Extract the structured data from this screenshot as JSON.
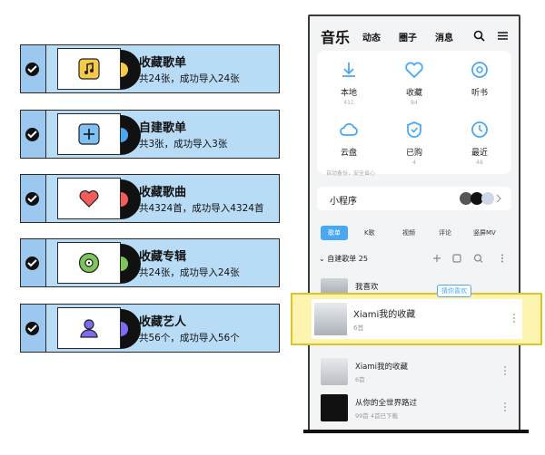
{
  "import_cards": [
    {
      "title": "收藏歌单",
      "subtitle": "共24张，成功导入24张",
      "icon": "music-note-icon",
      "accent": "#f7c948"
    },
    {
      "title": "自建歌单",
      "subtitle": "共3张，成功导入3张",
      "icon": "plus-icon",
      "accent": "#4aa8f2"
    },
    {
      "title": "收藏歌曲",
      "subtitle": "共4324首，成功导入4324首",
      "icon": "heart-icon",
      "accent": "#f25c5c"
    },
    {
      "title": "收藏专辑",
      "subtitle": "共24张，成功导入24张",
      "icon": "album-disc-icon",
      "accent": "#7dc45a"
    },
    {
      "title": "收藏艺人",
      "subtitle": "共56个，成功导入56个",
      "icon": "person-icon",
      "accent": "#7b6cf2"
    }
  ],
  "phone": {
    "tabs": {
      "main": "音乐",
      "t1": "动态",
      "t2": "圈子",
      "t3": "消息"
    },
    "grid": [
      {
        "label": "本地",
        "count": "411",
        "icon": "download-icon"
      },
      {
        "label": "收藏",
        "count": "84",
        "icon": "heart-outline-icon"
      },
      {
        "label": "听书",
        "count": "",
        "icon": "audiobook-icon"
      },
      {
        "label": "云盘",
        "count": "",
        "icon": "cloud-icon"
      },
      {
        "label": "已购",
        "count": "4",
        "icon": "purchased-icon"
      },
      {
        "label": "最近",
        "count": "48",
        "icon": "clock-icon"
      }
    ],
    "cloud_desc": "自动备份，安全省心",
    "mini_program": "小程序",
    "subtabs": [
      "歌单",
      "K歌",
      "视频",
      "评论",
      "竖屏MV"
    ],
    "section": {
      "title": "自建歌单",
      "count": "25"
    },
    "rows": [
      {
        "title": "我喜欢",
        "subtitle": "",
        "badge": "猜你喜欢"
      },
      {
        "title": "Xiami我的收藏",
        "subtitle": "6首"
      },
      {
        "title": "Xiami我的收藏",
        "subtitle": "6首"
      },
      {
        "title": "从你的全世界路过",
        "subtitle": "99首   4首已下载"
      }
    ]
  },
  "colors": {
    "card_bg": "#b9dcf6",
    "accent_blue": "#4aa8f2",
    "highlight": "#fdf4b0"
  }
}
